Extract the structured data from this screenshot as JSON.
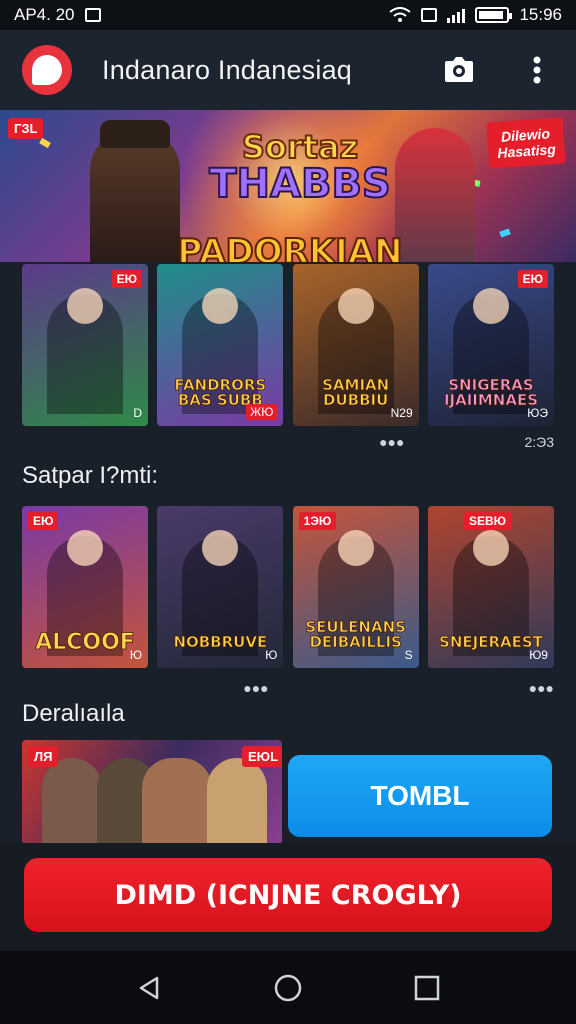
{
  "status_bar": {
    "time_left": "AP4. 20",
    "time_right": "15:96",
    "battery_level": 0.8
  },
  "app_bar": {
    "title": "Indanaro Indanesiaq",
    "logo_icon": "app-logo-icon",
    "action_icons": [
      "camera-icon",
      "more-vert-icon"
    ]
  },
  "banner": {
    "title_line1": "Sortaz",
    "title_line2": "THABBS",
    "subtitle": "PADORKIAN",
    "tag_left": "ГЗL",
    "tag_right": "Dilewio Hasatisg"
  },
  "row1": {
    "cards": [
      {
        "badge": "ЕЮ",
        "title": "",
        "num": "D",
        "colors": [
          "#5c3a8c",
          "#2f8a47"
        ]
      },
      {
        "badge": "",
        "title": "FANDRORS BAS SUBB",
        "num": "ЖЮ",
        "colors": [
          "#1e8f8a",
          "#7a3aa6"
        ]
      },
      {
        "badge": "",
        "title": "SAMIAN DUBBIU",
        "num": "N29",
        "colors": [
          "#a8642a",
          "#3b2a2a"
        ]
      },
      {
        "badge": "ЕЮ",
        "title": "SNIGERAS IJAIIMNAES",
        "num": "ЮЭ",
        "colors": [
          "#3a4a8a",
          "#1d2336"
        ]
      }
    ],
    "dots_left": "●●●",
    "dots_right": "2:Э3"
  },
  "section1_title": "Satpar I?mti:",
  "row2": {
    "cards": [
      {
        "badge": "ЕЮ",
        "title": "ALCOOF",
        "num": "Ю",
        "colors": [
          "#7a3aa6",
          "#c4553a"
        ]
      },
      {
        "badge": "",
        "title": "NOBBRUVE",
        "num": "Ю",
        "colors": [
          "#4a3a6a",
          "#232838"
        ]
      },
      {
        "badge": "1ЭЮ",
        "title": "SEULENANS DEIBAILLIS",
        "num": "S",
        "colors": [
          "#c4553a",
          "#3a5a8a"
        ]
      },
      {
        "badge": "SЕBЮ",
        "title": "SNEJERAEST",
        "num": "Ю9",
        "colors": [
          "#b0452f",
          "#2f3a5a"
        ]
      }
    ],
    "dots_left": "●●●",
    "dots_right": "●●●"
  },
  "section2_title": "Deralıaıla",
  "promo": {
    "tag_left": "ЛЯ",
    "tag_right": "ЕЮL",
    "side_button": "TOMBL"
  },
  "cta_main": "DIMD (ICNJNE CROGLY)",
  "nav": {
    "icons": [
      "back-icon",
      "home-icon",
      "recents-icon"
    ]
  }
}
